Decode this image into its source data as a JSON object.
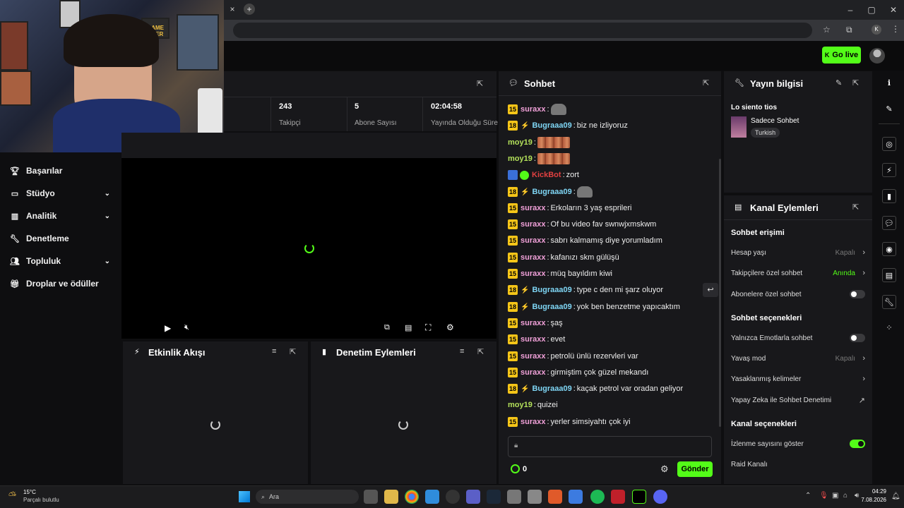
{
  "browser": {
    "add_tab": "+",
    "close_tab": "×",
    "minimize": "–",
    "maximize": "▢",
    "close": "✕",
    "profile": "K"
  },
  "topbar": {
    "go_live": "Go live"
  },
  "webcam": {
    "poster_text": "GAME OVER"
  },
  "sidebar": {
    "items": [
      {
        "label": "Başarılar",
        "icon": "trophy-icon",
        "has_chevron": false
      },
      {
        "label": "Stüdyo",
        "icon": "studio-icon",
        "has_chevron": true
      },
      {
        "label": "Analitik",
        "icon": "chart-icon",
        "has_chevron": true
      },
      {
        "label": "Denetleme",
        "icon": "wrench-icon",
        "has_chevron": false
      },
      {
        "label": "Topluluk",
        "icon": "people-icon",
        "has_chevron": true
      },
      {
        "label": "Droplar ve ödüller",
        "icon": "gift-icon",
        "has_chevron": false
      }
    ]
  },
  "stats": [
    {
      "value": "243",
      "label": "Takipçi"
    },
    {
      "value": "5",
      "label": "Abone Sayısı"
    },
    {
      "value": "02:04:58",
      "label": "Yayında Olduğu Süre"
    }
  ],
  "panels": {
    "activity_title": "Etkinlik Akışı",
    "mod_actions_title": "Denetim Eylemleri"
  },
  "chat": {
    "title": "Sohbet",
    "messages": [
      {
        "badge": "15",
        "user": "suraxx",
        "text": "",
        "emote": "small"
      },
      {
        "badge": "18",
        "user": "Bugraaa09",
        "text": "biz ne izliyoruz"
      },
      {
        "badge": "",
        "user": "moy19",
        "text": "",
        "emote": "big"
      },
      {
        "badge": "",
        "user": "moy19",
        "text": "",
        "emote": "big"
      },
      {
        "badge": "",
        "user": "KickBot",
        "text": "zort"
      },
      {
        "badge": "18",
        "user": "Bugraaa09",
        "text": "",
        "emote": "small"
      },
      {
        "badge": "15",
        "user": "suraxx",
        "text": "Erkoların 3 yaş esprileri"
      },
      {
        "badge": "15",
        "user": "suraxx",
        "text": "Of bu video fav swnwjxmskwm"
      },
      {
        "badge": "15",
        "user": "suraxx",
        "text": "sabrı kalmamış diye yorumladım"
      },
      {
        "badge": "15",
        "user": "suraxx",
        "text": "kafanızı skm gülüşü"
      },
      {
        "badge": "15",
        "user": "suraxx",
        "text": "müq bayıldım kiwi"
      },
      {
        "badge": "18",
        "user": "Bugraaa09",
        "text": "type c den mi şarz oluyor"
      },
      {
        "badge": "18",
        "user": "Bugraaa09",
        "text": "yok ben benzetme yapıcaktım"
      },
      {
        "badge": "15",
        "user": "suraxx",
        "text": "şaş"
      },
      {
        "badge": "15",
        "user": "suraxx",
        "text": "evet"
      },
      {
        "badge": "15",
        "user": "suraxx",
        "text": "petrolü ünlü rezervleri var"
      },
      {
        "badge": "15",
        "user": "suraxx",
        "text": "girmiştim çok güzel mekandı"
      },
      {
        "badge": "18",
        "user": "Bugraaa09",
        "text": "kaçak petrol var oradan geliyor"
      },
      {
        "badge": "",
        "user": "moy19",
        "text": "quizei"
      },
      {
        "badge": "15",
        "user": "suraxx",
        "text": "yerler simsiyahtı çok iyi"
      }
    ],
    "points": "0",
    "send_label": "Gönder"
  },
  "stream_info": {
    "title": "Yayın bilgisi",
    "stream_title": "Lo siento tios",
    "category": "Sadece Sohbet",
    "tag": "Turkish"
  },
  "channel_actions": {
    "title": "Kanal Eylemleri",
    "chat_access_heading": "Sohbet erişimi",
    "account_age": {
      "label": "Hesap yaşı",
      "value": "Kapalı"
    },
    "followers_only": {
      "label": "Takipçilere özel sohbet",
      "value": "Anında"
    },
    "subscribers_only": {
      "label": "Abonelere özel sohbet",
      "enabled": false
    },
    "chat_options_heading": "Sohbet seçenekleri",
    "emote_only": {
      "label": "Yalnızca Emotlarla sohbet",
      "enabled": false
    },
    "slow_mode": {
      "label": "Yavaş mod",
      "value": "Kapalı"
    },
    "banned_words": {
      "label": "Yasaklanmış kelimeler"
    },
    "ai_moderation": {
      "label": "Yapay Zeka ile Sohbet Denetimi"
    },
    "channel_options_heading": "Kanal seçenekleri",
    "show_viewers": {
      "label": "İzlenme sayısını göster",
      "enabled": true
    },
    "raid": {
      "label": "Raid Kanalı"
    }
  },
  "taskbar": {
    "weather_temp": "15°C",
    "weather_desc": "Parçalı bulutlu",
    "search": "Ara",
    "time": "04:29",
    "date": "7.08.2026"
  }
}
